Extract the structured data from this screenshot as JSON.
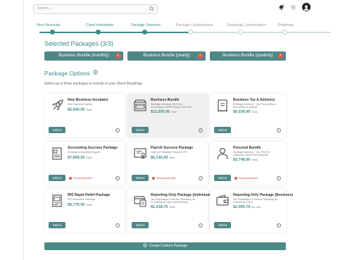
{
  "search": {
    "placeholder": "Search..."
  },
  "progress_steps": [
    {
      "label": "Firm Financials",
      "done": true
    },
    {
      "label": "Client Information",
      "done": true
    },
    {
      "label": "Package Overview",
      "done": true
    },
    {
      "label": "Package Customization",
      "done": false
    },
    {
      "label": "Roadmap Customization",
      "done": false
    },
    {
      "label": "Roadmap",
      "done": false
    }
  ],
  "selected": {
    "title": "Selected Packages (3/3)",
    "items": [
      "Business Bundle (monthly)",
      "Business Bundle (yearly)",
      "Business Bundle (quaterly)"
    ],
    "remove_glyph": "×"
  },
  "options": {
    "title": "Package Options",
    "subtitle": "Select up to three packages to include in your Client Roadmap.",
    "select_label": "Select",
    "recommended_label": "Recommended",
    "info_glyph": "i",
    "cards": [
      {
        "name": "New Business Incubator",
        "desc1": "New Business Startup",
        "desc2": "",
        "price": "$2,640.00",
        "unit": "Total",
        "icon": "rocket-icon",
        "selected": false,
        "recommended": false
      },
      {
        "name": "Business Bundle",
        "desc1": "Strategic Advisory, Tax Prep,",
        "desc2": "Accounting, and/or Payroll, all in one",
        "price": "$11,500.00",
        "unit": "Total",
        "icon": "storefront-icon",
        "selected": true,
        "recommended": false
      },
      {
        "name": "Business Tax & Advisory",
        "desc1": "Strategic Advisory + Tax Prep (without",
        "desc2": "accounting or payroll)",
        "price": "$6,036.00",
        "unit": "Total",
        "icon": "receipt-icon",
        "selected": false,
        "recommended": false
      },
      {
        "name": "Accounting Success Package",
        "desc1": "Strategic Accounting Support",
        "desc2": "",
        "price": "$7,868.00",
        "unit": "Total",
        "icon": "document-icon",
        "selected": false,
        "recommended": true
      },
      {
        "name": "Payroll Success Package",
        "desc1": "Help with Strategic Payroll & HR",
        "desc2": "",
        "price": "$6,316.00",
        "unit": "Total",
        "icon": "certificate-icon",
        "selected": false,
        "recommended": true
      },
      {
        "name": "Personal Bundle",
        "desc1": "Strategic Advisory + Tax Prep for",
        "desc2": "Individual Clients that Business",
        "price": "$3,748.00",
        "unit": "Total",
        "icon": "person-icon",
        "selected": false,
        "recommended": true
      },
      {
        "name": "IRS Rapid Relief Package",
        "desc1": "IRS Resolution Package",
        "desc2": "",
        "price": "$5,776.00",
        "unit": "Total",
        "icon": "tax-document-icon",
        "selected": false,
        "recommended": false
      },
      {
        "name": "Reporting-Only Package (Individual)",
        "desc1": "Tax Preparation & Income Reporting for",
        "desc2": "an Individual Client with Business",
        "price": "$1,418.75",
        "unit": "Total",
        "icon": "card-receipt-icon",
        "selected": false,
        "recommended": false
      },
      {
        "name": "Reporting-Only Package (Business)",
        "desc1": "Tax Preparation & Income Reporting for",
        "desc2": "a Business Client",
        "price": "$2,993.75",
        "unit": "per unit",
        "icon": "wallet-icon",
        "selected": false,
        "recommended": false
      }
    ]
  },
  "create_button": "Create Custom Package",
  "colors": {
    "accent": "#3f8a87",
    "button": "#4e8886",
    "danger": "#d85a5a",
    "muted_track": "#cfe0df"
  }
}
